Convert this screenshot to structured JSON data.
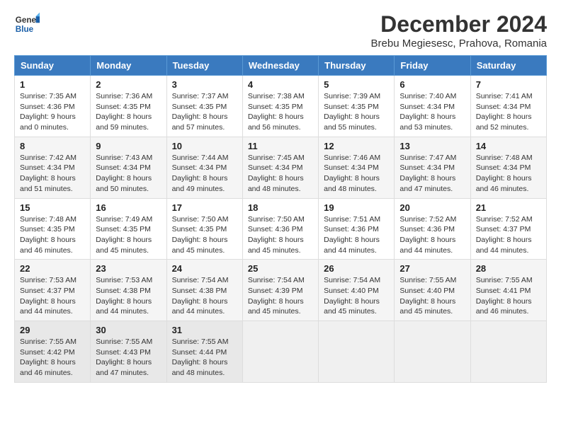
{
  "logo": {
    "line1": "General",
    "line2": "Blue"
  },
  "title": "December 2024",
  "location": "Brebu Megiesesc, Prahova, Romania",
  "days_of_week": [
    "Sunday",
    "Monday",
    "Tuesday",
    "Wednesday",
    "Thursday",
    "Friday",
    "Saturday"
  ],
  "weeks": [
    [
      {
        "day": 1,
        "sunrise": "7:35 AM",
        "sunset": "4:36 PM",
        "daylight": "9 hours and 0 minutes."
      },
      {
        "day": 2,
        "sunrise": "7:36 AM",
        "sunset": "4:35 PM",
        "daylight": "8 hours and 59 minutes."
      },
      {
        "day": 3,
        "sunrise": "7:37 AM",
        "sunset": "4:35 PM",
        "daylight": "8 hours and 57 minutes."
      },
      {
        "day": 4,
        "sunrise": "7:38 AM",
        "sunset": "4:35 PM",
        "daylight": "8 hours and 56 minutes."
      },
      {
        "day": 5,
        "sunrise": "7:39 AM",
        "sunset": "4:35 PM",
        "daylight": "8 hours and 55 minutes."
      },
      {
        "day": 6,
        "sunrise": "7:40 AM",
        "sunset": "4:34 PM",
        "daylight": "8 hours and 53 minutes."
      },
      {
        "day": 7,
        "sunrise": "7:41 AM",
        "sunset": "4:34 PM",
        "daylight": "8 hours and 52 minutes."
      }
    ],
    [
      {
        "day": 8,
        "sunrise": "7:42 AM",
        "sunset": "4:34 PM",
        "daylight": "8 hours and 51 minutes."
      },
      {
        "day": 9,
        "sunrise": "7:43 AM",
        "sunset": "4:34 PM",
        "daylight": "8 hours and 50 minutes."
      },
      {
        "day": 10,
        "sunrise": "7:44 AM",
        "sunset": "4:34 PM",
        "daylight": "8 hours and 49 minutes."
      },
      {
        "day": 11,
        "sunrise": "7:45 AM",
        "sunset": "4:34 PM",
        "daylight": "8 hours and 48 minutes."
      },
      {
        "day": 12,
        "sunrise": "7:46 AM",
        "sunset": "4:34 PM",
        "daylight": "8 hours and 48 minutes."
      },
      {
        "day": 13,
        "sunrise": "7:47 AM",
        "sunset": "4:34 PM",
        "daylight": "8 hours and 47 minutes."
      },
      {
        "day": 14,
        "sunrise": "7:48 AM",
        "sunset": "4:34 PM",
        "daylight": "8 hours and 46 minutes."
      }
    ],
    [
      {
        "day": 15,
        "sunrise": "7:48 AM",
        "sunset": "4:35 PM",
        "daylight": "8 hours and 46 minutes."
      },
      {
        "day": 16,
        "sunrise": "7:49 AM",
        "sunset": "4:35 PM",
        "daylight": "8 hours and 45 minutes."
      },
      {
        "day": 17,
        "sunrise": "7:50 AM",
        "sunset": "4:35 PM",
        "daylight": "8 hours and 45 minutes."
      },
      {
        "day": 18,
        "sunrise": "7:50 AM",
        "sunset": "4:36 PM",
        "daylight": "8 hours and 45 minutes."
      },
      {
        "day": 19,
        "sunrise": "7:51 AM",
        "sunset": "4:36 PM",
        "daylight": "8 hours and 44 minutes."
      },
      {
        "day": 20,
        "sunrise": "7:52 AM",
        "sunset": "4:36 PM",
        "daylight": "8 hours and 44 minutes."
      },
      {
        "day": 21,
        "sunrise": "7:52 AM",
        "sunset": "4:37 PM",
        "daylight": "8 hours and 44 minutes."
      }
    ],
    [
      {
        "day": 22,
        "sunrise": "7:53 AM",
        "sunset": "4:37 PM",
        "daylight": "8 hours and 44 minutes."
      },
      {
        "day": 23,
        "sunrise": "7:53 AM",
        "sunset": "4:38 PM",
        "daylight": "8 hours and 44 minutes."
      },
      {
        "day": 24,
        "sunrise": "7:54 AM",
        "sunset": "4:38 PM",
        "daylight": "8 hours and 44 minutes."
      },
      {
        "day": 25,
        "sunrise": "7:54 AM",
        "sunset": "4:39 PM",
        "daylight": "8 hours and 45 minutes."
      },
      {
        "day": 26,
        "sunrise": "7:54 AM",
        "sunset": "4:40 PM",
        "daylight": "8 hours and 45 minutes."
      },
      {
        "day": 27,
        "sunrise": "7:55 AM",
        "sunset": "4:40 PM",
        "daylight": "8 hours and 45 minutes."
      },
      {
        "day": 28,
        "sunrise": "7:55 AM",
        "sunset": "4:41 PM",
        "daylight": "8 hours and 46 minutes."
      }
    ],
    [
      {
        "day": 29,
        "sunrise": "7:55 AM",
        "sunset": "4:42 PM",
        "daylight": "8 hours and 46 minutes."
      },
      {
        "day": 30,
        "sunrise": "7:55 AM",
        "sunset": "4:43 PM",
        "daylight": "8 hours and 47 minutes."
      },
      {
        "day": 31,
        "sunrise": "7:55 AM",
        "sunset": "4:44 PM",
        "daylight": "8 hours and 48 minutes."
      },
      null,
      null,
      null,
      null
    ]
  ]
}
